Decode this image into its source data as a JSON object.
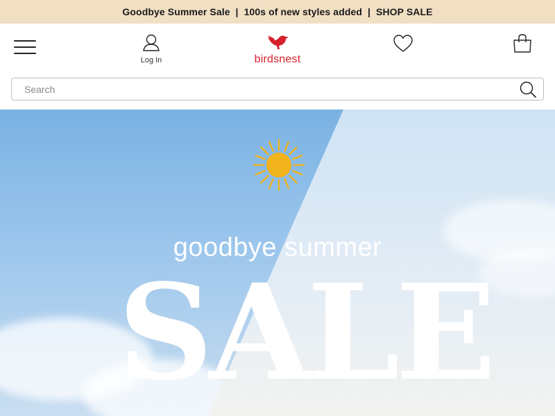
{
  "promo": {
    "part1": "Goodbye Summer Sale",
    "sep1": "  |  ",
    "part2": "100s of new styles added",
    "sep2": "  |  ",
    "part3": "SHOP SALE"
  },
  "header": {
    "menu_icon": "hamburger-icon",
    "login_label": "Log In",
    "login_icon": "user-icon",
    "logo_text": "birdsnest",
    "logo_icon": "bird-icon",
    "wishlist_icon": "heart-icon",
    "bag_icon": "shopping-bag-icon"
  },
  "search": {
    "placeholder": "Search",
    "icon": "search-icon"
  },
  "hero": {
    "line1": "goodbye summer",
    "line2": "SALE",
    "sun_icon": "sun-icon",
    "sun_color": "#f2b41c"
  },
  "colors": {
    "promo_bg": "#f1dfc4",
    "brand_red": "#d6202a",
    "text_dark": "#1a1a1a"
  }
}
